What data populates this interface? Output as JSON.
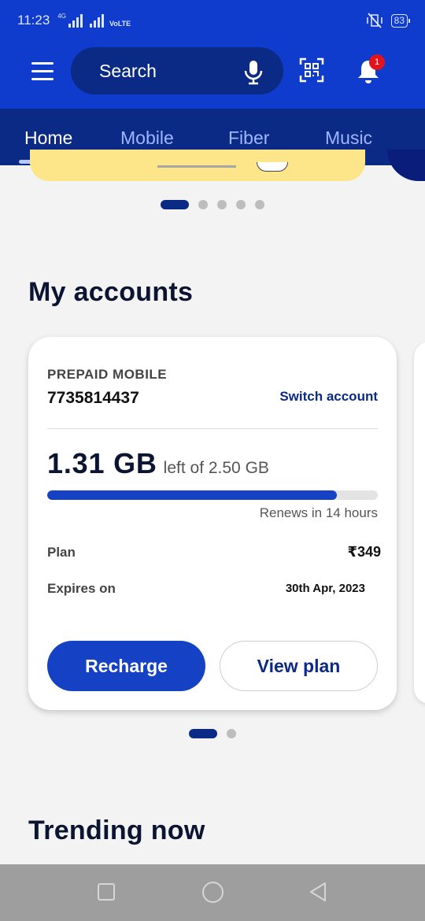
{
  "status_bar": {
    "time": "11:23",
    "network_label": "4G",
    "volte_label": "VoLTE",
    "battery": "83"
  },
  "header": {
    "search_placeholder": "Search",
    "notification_count": "1"
  },
  "tabs": [
    {
      "label": "Home",
      "active": true
    },
    {
      "label": "Mobile",
      "active": false
    },
    {
      "label": "Fiber",
      "active": false
    },
    {
      "label": "Music",
      "active": false
    }
  ],
  "banner_carousel": {
    "slides": 5,
    "active_index": 0
  },
  "accounts": {
    "title": "My accounts",
    "card": {
      "type": "PREPAID MOBILE",
      "number": "7735814437",
      "switch_label": "Switch account",
      "data_left": "1.31 GB",
      "data_total_label": "left of 2.50 GB",
      "usage_fraction": 0.876,
      "renews": "Renews in 14 hours",
      "plan_label": "Plan",
      "plan_value": "₹349",
      "expires_label": "Expires on",
      "expires_value": "30th Apr, 2023",
      "recharge_label": "Recharge",
      "view_plan_label": "View plan"
    },
    "carousel": {
      "slides": 2,
      "active_index": 0
    }
  },
  "trending": {
    "title": "Trending now"
  },
  "colors": {
    "primary": "#0f3ccc",
    "primary_dark": "#0a2a86",
    "button_blue": "#1542c4",
    "badge_red": "#e1141e"
  }
}
